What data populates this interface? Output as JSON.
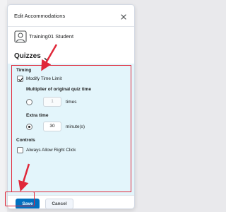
{
  "dialog": {
    "title": "Edit Accommodations",
    "close_icon": "close-icon"
  },
  "user": {
    "name": "Training01 Student",
    "icon": "user-icon"
  },
  "section": {
    "title": "Quizzes",
    "icon": "chevron-down-icon"
  },
  "timing": {
    "heading": "Timing",
    "modify_time_limit_label": "Modify Time Limit",
    "modify_time_limit_checked": true,
    "multiplier_heading": "Multiplier of original quiz time",
    "multiplier_value": "1",
    "multiplier_unit": "times",
    "multiplier_selected": false,
    "extra_time_heading": "Extra time",
    "extra_time_value": "30",
    "extra_time_unit": "minute(s)",
    "extra_time_selected": true
  },
  "controls": {
    "heading": "Controls",
    "right_click_label": "Always Allow Right Click",
    "right_click_checked": false
  },
  "footer": {
    "save_label": "Save",
    "cancel_label": "Cancel"
  },
  "colors": {
    "accent": "#006fbf",
    "highlight": "#e0283a",
    "panel": "#e3f5fb"
  }
}
